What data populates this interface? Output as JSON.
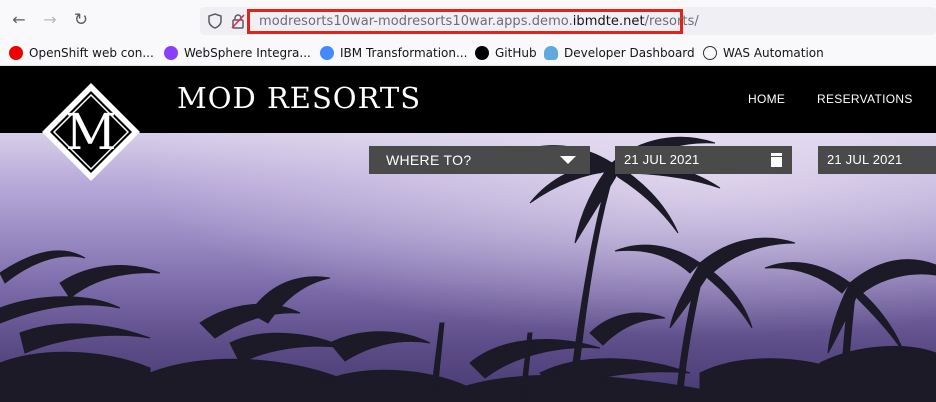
{
  "browser": {
    "url_prefix": "modresorts10war-modresorts10war.apps.demo.",
    "url_domain": "ibmdte.net",
    "url_path": "/resorts/",
    "bookmarks": [
      {
        "label": "OpenShift web con...",
        "icon": "openshift-icon",
        "color": "#e00"
      },
      {
        "label": "WebSphere Integra...",
        "icon": "websphere-icon",
        "color": "#8a3ffc"
      },
      {
        "label": "IBM Transformation...",
        "icon": "ibm-transformation-icon",
        "color": "#4589ff"
      },
      {
        "label": "GitHub",
        "icon": "github-icon",
        "color": "#000"
      },
      {
        "label": "Developer Dashboard",
        "icon": "cloud-icon",
        "color": "#5fa8e0"
      },
      {
        "label": "WAS Automation",
        "icon": "globe-icon",
        "color": "#333"
      }
    ]
  },
  "site": {
    "logo_letter": "M",
    "title": "MOD RESORTS",
    "nav": [
      "HOME",
      "RESERVATIONS"
    ]
  },
  "search": {
    "where_label": "WHERE TO?",
    "check_in": "21 JUL 2021",
    "check_out": "21 JUL 2021"
  },
  "colors": {
    "url_highlight": "#e2231a",
    "header_bg": "#000000",
    "filter_bg": "#4a4a4a"
  }
}
